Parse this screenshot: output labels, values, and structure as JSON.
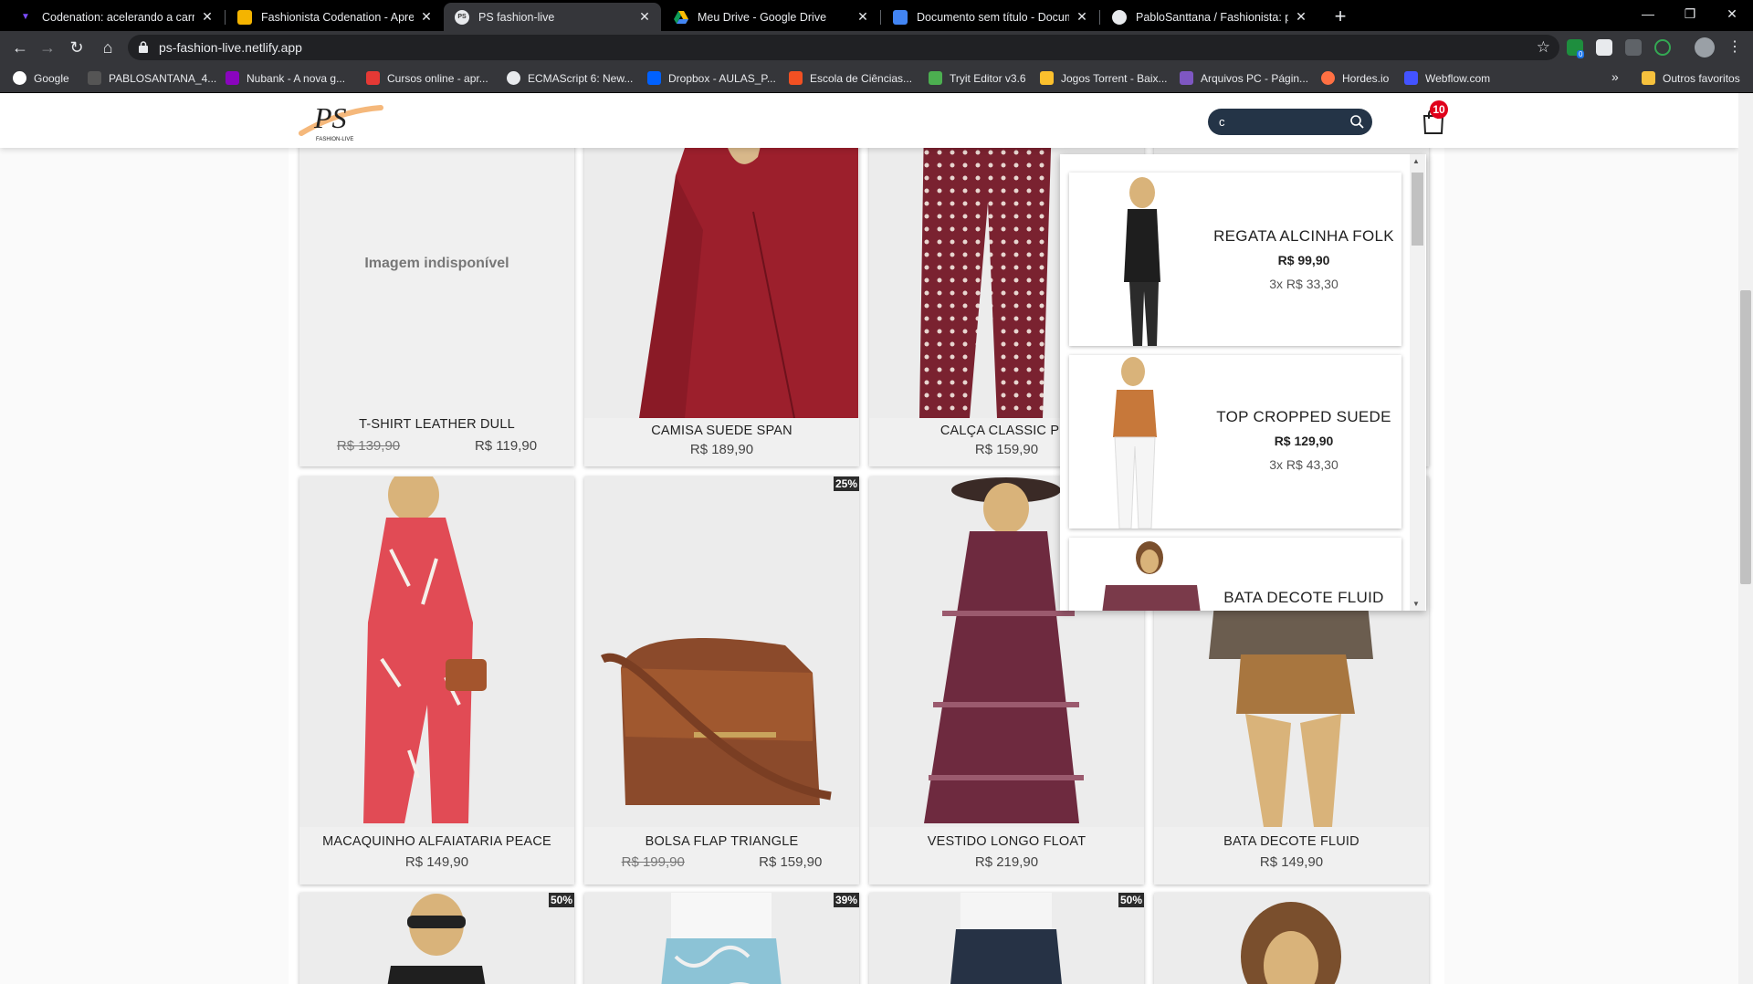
{
  "browser": {
    "tabs": [
      {
        "title": "Codenation: acelerando a carreira",
        "favicon": "codenation-icon"
      },
      {
        "title": "Fashionista Codenation - Apresentação",
        "favicon": "slides-icon"
      },
      {
        "title": "PS fashion-live",
        "favicon": "site-icon",
        "active": true
      },
      {
        "title": "Meu Drive - Google Drive",
        "favicon": "drive-icon"
      },
      {
        "title": "Documento sem título - Documentos",
        "favicon": "docs-icon"
      },
      {
        "title": "PabloSanttana / Fashionista: projeto",
        "favicon": "github-icon"
      }
    ],
    "url": "ps-fashion-live.netlify.app",
    "bookmarks": [
      {
        "label": "Google"
      },
      {
        "label": "PABLOSANTANA_4..."
      },
      {
        "label": "Nubank - A nova g..."
      },
      {
        "label": "Cursos online - apr..."
      },
      {
        "label": "ECMAScript 6: New..."
      },
      {
        "label": "Dropbox - AULAS_P..."
      },
      {
        "label": "Escola de Ciências..."
      },
      {
        "label": "Tryit Editor v3.6"
      },
      {
        "label": "Jogos Torrent - Baix..."
      },
      {
        "label": "Arquivos PC - Págin..."
      },
      {
        "label": "Hordes.io"
      },
      {
        "label": "Webflow.com"
      }
    ],
    "bookmarks_overflow": "»",
    "other_bookmarks": "Outros favoritos",
    "ext_badge": "0"
  },
  "header": {
    "logo_text": "PS",
    "logo_sub": "FASHION-LIVE",
    "search_value": "c",
    "cart_count": "10"
  },
  "products": {
    "row1": [
      {
        "name": "T-SHIRT LEATHER DULL",
        "old_price": "R$ 139,90",
        "price": "R$ 119,90",
        "unavailable": "Imagem indisponível"
      },
      {
        "name": "CAMISA SUEDE SPAN",
        "price": "R$ 189,90"
      },
      {
        "name": "CALÇA CLASSIC PRI",
        "price": "R$ 159,90"
      }
    ],
    "row2": [
      {
        "name": "MACAQUINHO ALFAIATARIA PEACE",
        "price": "R$ 149,90"
      },
      {
        "name": "BOLSA FLAP TRIANGLE",
        "old_price": "R$ 199,90",
        "price": "R$ 159,90",
        "badge": "25%"
      },
      {
        "name": "VESTIDO LONGO FLOAT",
        "price": "R$ 219,90"
      },
      {
        "name": "BATA DECOTE FLUID",
        "price": "R$ 149,90"
      }
    ],
    "row3_badges": [
      "50%",
      "39%",
      "50%"
    ]
  },
  "search_results": [
    {
      "name": "REGATA ALCINHA FOLK",
      "price": "R$ 99,90",
      "installments": "3x R$ 33,30"
    },
    {
      "name": "TOP CROPPED SUEDE",
      "price": "R$ 129,90",
      "installments": "3x R$ 43,30"
    },
    {
      "name": "BATA DECOTE FLUID"
    }
  ],
  "colors": {
    "search_bg": "#243447",
    "cart_badge": "#e0001b",
    "logo_accent": "#f2a65a"
  }
}
